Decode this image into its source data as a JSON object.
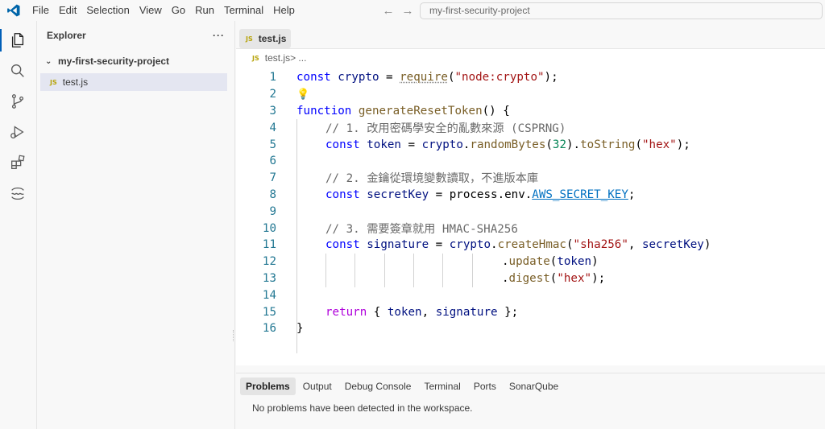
{
  "menu": [
    "File",
    "Edit",
    "Selection",
    "View",
    "Go",
    "Run",
    "Terminal",
    "Help"
  ],
  "search": {
    "text": "my-first-security-project"
  },
  "sidebar": {
    "title": "Explorer",
    "more": "···",
    "folder": "my-first-security-project",
    "file_badge": "JS",
    "file": "test.js"
  },
  "editor": {
    "tab_badge": "JS",
    "tab_label": "test.js",
    "breadcrumb_badge": "JS",
    "breadcrumb_file": "test.js",
    "breadcrumb_rest": " > ..."
  },
  "code": {
    "line_numbers": [
      "1",
      "2",
      "3",
      "4",
      "5",
      "6",
      "7",
      "8",
      "9",
      "10",
      "11",
      "12",
      "13",
      "14",
      "15",
      "16"
    ],
    "l1": {
      "kw": "const",
      "var": "crypto",
      "eq": " = ",
      "fn": "require",
      "open": "(",
      "str": "\"node:crypto\"",
      "close": ");"
    },
    "l3": {
      "kw": "function",
      "fn": "generateResetToken",
      "rest": "() {"
    },
    "l4": "// 1. 改用密碼學安全的亂數來源 (CSPRNG)",
    "l5": {
      "kw": "const",
      "var": "token",
      "eq": " = ",
      "obj": "crypto",
      "dot": ".",
      "fn": "randomBytes",
      "p1": "(",
      "num": "32",
      "p2": ").",
      "fn2": "toString",
      "p3": "(",
      "str": "\"hex\"",
      "p4": ");"
    },
    "l7": "// 2. 金鑰從環境變數讀取，不進版本庫",
    "l8": {
      "kw": "const",
      "var": "secretKey",
      "eq": " = ",
      "obj": "process",
      "dot": ".",
      "obj2": "env",
      "dot2": ".",
      "cls": "AWS_SECRET_KEY",
      "end": ";"
    },
    "l10": "// 3. 需要簽章就用 HMAC-SHA256",
    "l11": {
      "kw": "const",
      "var": "signature",
      "eq": " = ",
      "obj": "crypto",
      "dot": ".",
      "fn": "createHmac",
      "p1": "(",
      "str": "\"sha256\"",
      "comma": ", ",
      "arg": "secretKey",
      "p2": ")"
    },
    "l12": {
      "dot": ".",
      "fn": "update",
      "p1": "(",
      "arg": "token",
      "p2": ")"
    },
    "l13": {
      "dot": ".",
      "fn": "digest",
      "p1": "(",
      "str": "\"hex\"",
      "p2": ");"
    },
    "l15": {
      "kw": "return",
      "open": " { ",
      "a": "token",
      "comma": ", ",
      "b": "signature",
      "close": " };"
    },
    "l16": "}"
  },
  "panel": {
    "tabs": [
      "Problems",
      "Output",
      "Debug Console",
      "Terminal",
      "Ports",
      "SonarQube"
    ],
    "message": "No problems have been detected in the workspace."
  },
  "colors": {
    "accent": "#005fb8",
    "vscode_logo": "#0065a9",
    "js_badge": "#b7a40b"
  }
}
